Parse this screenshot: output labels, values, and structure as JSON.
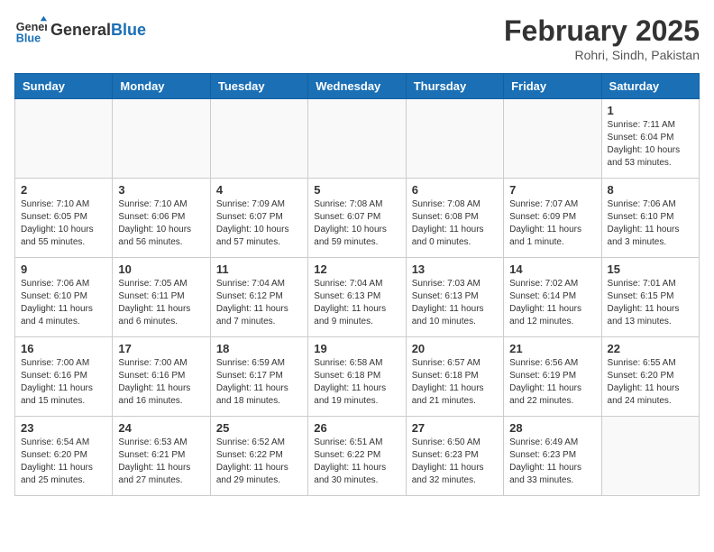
{
  "logo": {
    "general": "General",
    "blue": "Blue"
  },
  "header": {
    "title": "February 2025",
    "subtitle": "Rohri, Sindh, Pakistan"
  },
  "weekdays": [
    "Sunday",
    "Monday",
    "Tuesday",
    "Wednesday",
    "Thursday",
    "Friday",
    "Saturday"
  ],
  "weeks": [
    [
      {
        "day": "",
        "info": ""
      },
      {
        "day": "",
        "info": ""
      },
      {
        "day": "",
        "info": ""
      },
      {
        "day": "",
        "info": ""
      },
      {
        "day": "",
        "info": ""
      },
      {
        "day": "",
        "info": ""
      },
      {
        "day": "1",
        "info": "Sunrise: 7:11 AM\nSunset: 6:04 PM\nDaylight: 10 hours\nand 53 minutes."
      }
    ],
    [
      {
        "day": "2",
        "info": "Sunrise: 7:10 AM\nSunset: 6:05 PM\nDaylight: 10 hours\nand 55 minutes."
      },
      {
        "day": "3",
        "info": "Sunrise: 7:10 AM\nSunset: 6:06 PM\nDaylight: 10 hours\nand 56 minutes."
      },
      {
        "day": "4",
        "info": "Sunrise: 7:09 AM\nSunset: 6:07 PM\nDaylight: 10 hours\nand 57 minutes."
      },
      {
        "day": "5",
        "info": "Sunrise: 7:08 AM\nSunset: 6:07 PM\nDaylight: 10 hours\nand 59 minutes."
      },
      {
        "day": "6",
        "info": "Sunrise: 7:08 AM\nSunset: 6:08 PM\nDaylight: 11 hours\nand 0 minutes."
      },
      {
        "day": "7",
        "info": "Sunrise: 7:07 AM\nSunset: 6:09 PM\nDaylight: 11 hours\nand 1 minute."
      },
      {
        "day": "8",
        "info": "Sunrise: 7:06 AM\nSunset: 6:10 PM\nDaylight: 11 hours\nand 3 minutes."
      }
    ],
    [
      {
        "day": "9",
        "info": "Sunrise: 7:06 AM\nSunset: 6:10 PM\nDaylight: 11 hours\nand 4 minutes."
      },
      {
        "day": "10",
        "info": "Sunrise: 7:05 AM\nSunset: 6:11 PM\nDaylight: 11 hours\nand 6 minutes."
      },
      {
        "day": "11",
        "info": "Sunrise: 7:04 AM\nSunset: 6:12 PM\nDaylight: 11 hours\nand 7 minutes."
      },
      {
        "day": "12",
        "info": "Sunrise: 7:04 AM\nSunset: 6:13 PM\nDaylight: 11 hours\nand 9 minutes."
      },
      {
        "day": "13",
        "info": "Sunrise: 7:03 AM\nSunset: 6:13 PM\nDaylight: 11 hours\nand 10 minutes."
      },
      {
        "day": "14",
        "info": "Sunrise: 7:02 AM\nSunset: 6:14 PM\nDaylight: 11 hours\nand 12 minutes."
      },
      {
        "day": "15",
        "info": "Sunrise: 7:01 AM\nSunset: 6:15 PM\nDaylight: 11 hours\nand 13 minutes."
      }
    ],
    [
      {
        "day": "16",
        "info": "Sunrise: 7:00 AM\nSunset: 6:16 PM\nDaylight: 11 hours\nand 15 minutes."
      },
      {
        "day": "17",
        "info": "Sunrise: 7:00 AM\nSunset: 6:16 PM\nDaylight: 11 hours\nand 16 minutes."
      },
      {
        "day": "18",
        "info": "Sunrise: 6:59 AM\nSunset: 6:17 PM\nDaylight: 11 hours\nand 18 minutes."
      },
      {
        "day": "19",
        "info": "Sunrise: 6:58 AM\nSunset: 6:18 PM\nDaylight: 11 hours\nand 19 minutes."
      },
      {
        "day": "20",
        "info": "Sunrise: 6:57 AM\nSunset: 6:18 PM\nDaylight: 11 hours\nand 21 minutes."
      },
      {
        "day": "21",
        "info": "Sunrise: 6:56 AM\nSunset: 6:19 PM\nDaylight: 11 hours\nand 22 minutes."
      },
      {
        "day": "22",
        "info": "Sunrise: 6:55 AM\nSunset: 6:20 PM\nDaylight: 11 hours\nand 24 minutes."
      }
    ],
    [
      {
        "day": "23",
        "info": "Sunrise: 6:54 AM\nSunset: 6:20 PM\nDaylight: 11 hours\nand 25 minutes."
      },
      {
        "day": "24",
        "info": "Sunrise: 6:53 AM\nSunset: 6:21 PM\nDaylight: 11 hours\nand 27 minutes."
      },
      {
        "day": "25",
        "info": "Sunrise: 6:52 AM\nSunset: 6:22 PM\nDaylight: 11 hours\nand 29 minutes."
      },
      {
        "day": "26",
        "info": "Sunrise: 6:51 AM\nSunset: 6:22 PM\nDaylight: 11 hours\nand 30 minutes."
      },
      {
        "day": "27",
        "info": "Sunrise: 6:50 AM\nSunset: 6:23 PM\nDaylight: 11 hours\nand 32 minutes."
      },
      {
        "day": "28",
        "info": "Sunrise: 6:49 AM\nSunset: 6:23 PM\nDaylight: 11 hours\nand 33 minutes."
      },
      {
        "day": "",
        "info": ""
      }
    ]
  ]
}
